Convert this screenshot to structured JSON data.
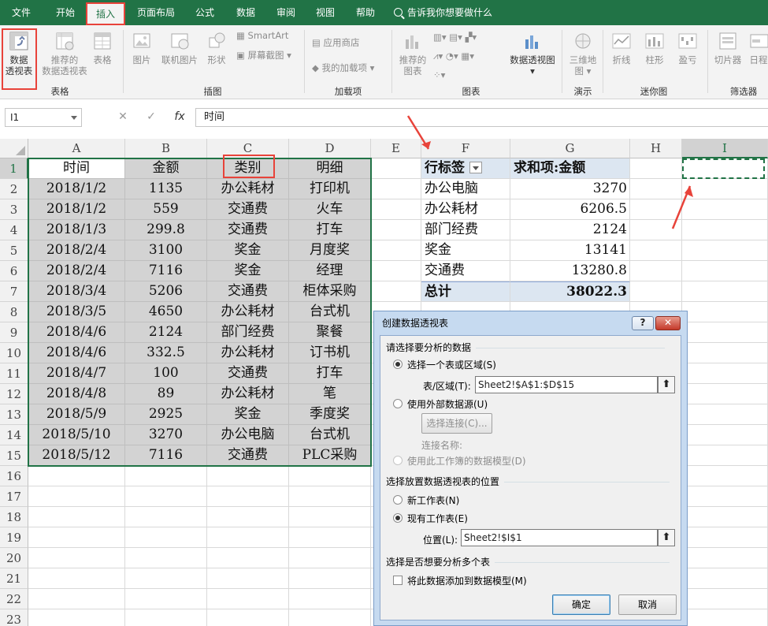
{
  "ribbon_tabs": [
    "文件",
    "开始",
    "插入",
    "页面布局",
    "公式",
    "数据",
    "审阅",
    "视图",
    "帮助"
  ],
  "tell_me": "告诉我你想要做什么",
  "ribbon": {
    "pivot_line1": "数据",
    "pivot_line2": "透视表",
    "rec_pivot_line1": "推荐的",
    "rec_pivot_line2": "数据透视表",
    "table": "表格",
    "group_tables": "表格",
    "picture": "图片",
    "online_picture": "联机图片",
    "shapes": "形状",
    "smartart": "SmartArt",
    "screenshot": "屏幕截图",
    "group_illustrations": "插图",
    "app_store": "应用商店",
    "my_addins": "我的加载项",
    "group_addins": "加载项",
    "rec_charts_line1": "推荐的",
    "rec_charts_line2": "图表",
    "pivot_chart": "数据透视图",
    "group_charts": "图表",
    "map3d_line1": "三维地",
    "map3d_line2": "图",
    "group_tours": "演示",
    "spark_line": "折线",
    "spark_column": "柱形",
    "spark_winloss": "盈亏",
    "group_sparklines": "迷你图",
    "slicer": "切片器",
    "timeline": "日程",
    "group_filters": "筛选器"
  },
  "formula_bar": {
    "name_box": "I1",
    "cancel": "✕",
    "enter": "✓",
    "fx": "fx",
    "content": "时间"
  },
  "columns": [
    "A",
    "B",
    "C",
    "D",
    "E",
    "F",
    "G",
    "H",
    "I"
  ],
  "rows": [
    "1",
    "2",
    "3",
    "4",
    "5",
    "6",
    "7",
    "8",
    "9",
    "10",
    "11",
    "12",
    "13",
    "14",
    "15",
    "16",
    "17",
    "18",
    "19",
    "20",
    "21",
    "22",
    "23"
  ],
  "headers": [
    "时间",
    "金额",
    "类别",
    "明细"
  ],
  "data": [
    [
      "2018/1/2",
      "1135",
      "办公耗材",
      "打印机"
    ],
    [
      "2018/1/2",
      "559",
      "交通费",
      "火车"
    ],
    [
      "2018/1/3",
      "299.8",
      "交通费",
      "打车"
    ],
    [
      "2018/2/4",
      "3100",
      "奖金",
      "月度奖"
    ],
    [
      "2018/2/4",
      "7116",
      "奖金",
      "经理"
    ],
    [
      "2018/3/4",
      "5206",
      "交通费",
      "柜体采购"
    ],
    [
      "2018/3/5",
      "4650",
      "办公耗材",
      "台式机"
    ],
    [
      "2018/4/6",
      "2124",
      "部门经费",
      "聚餐"
    ],
    [
      "2018/4/6",
      "332.5",
      "办公耗材",
      "订书机"
    ],
    [
      "2018/4/7",
      "100",
      "交通费",
      "打车"
    ],
    [
      "2018/4/8",
      "89",
      "办公耗材",
      "笔"
    ],
    [
      "2018/5/9",
      "2925",
      "奖金",
      "季度奖"
    ],
    [
      "2018/5/10",
      "3270",
      "办公电脑",
      "台式机"
    ],
    [
      "2018/5/12",
      "7116",
      "交通费",
      "PLC采购"
    ]
  ],
  "pivot": {
    "row_label": "行标签",
    "value_label": "求和项:金额",
    "rows": [
      [
        "办公电脑",
        "3270"
      ],
      [
        "办公耗材",
        "6206.5"
      ],
      [
        "部门经费",
        "2124"
      ],
      [
        "奖金",
        "13141"
      ],
      [
        "交通费",
        "13280.8"
      ]
    ],
    "total_label": "总计",
    "total_value": "38022.3"
  },
  "dialog": {
    "title": "创建数据透视表",
    "help": "?",
    "close": "✕",
    "section1": "请选择要分析的数据",
    "opt_range": "选择一个表或区域(S)",
    "range_label": "表/区域(T):",
    "range_value": "Sheet2!$A$1:$D$15",
    "opt_external": "使用外部数据源(U)",
    "choose_conn": "选择连接(C)...",
    "conn_name": "连接名称:",
    "opt_datamodel": "使用此工作簿的数据模型(D)",
    "section2": "选择放置数据透视表的位置",
    "opt_new_sheet": "新工作表(N)",
    "opt_existing": "现有工作表(E)",
    "location_label": "位置(L):",
    "location_value": "Sheet2!$I$1",
    "section3": "选择是否想要分析多个表",
    "add_model": "将此数据添加到数据模型(M)",
    "ok": "确定",
    "cancel": "取消",
    "collapse_icon": "⬆"
  },
  "colors": {
    "excel_green": "#217346",
    "highlight_red": "#e8433a",
    "pivot_header": "#dce6f1",
    "dialog_frame": "#c6daf0"
  }
}
